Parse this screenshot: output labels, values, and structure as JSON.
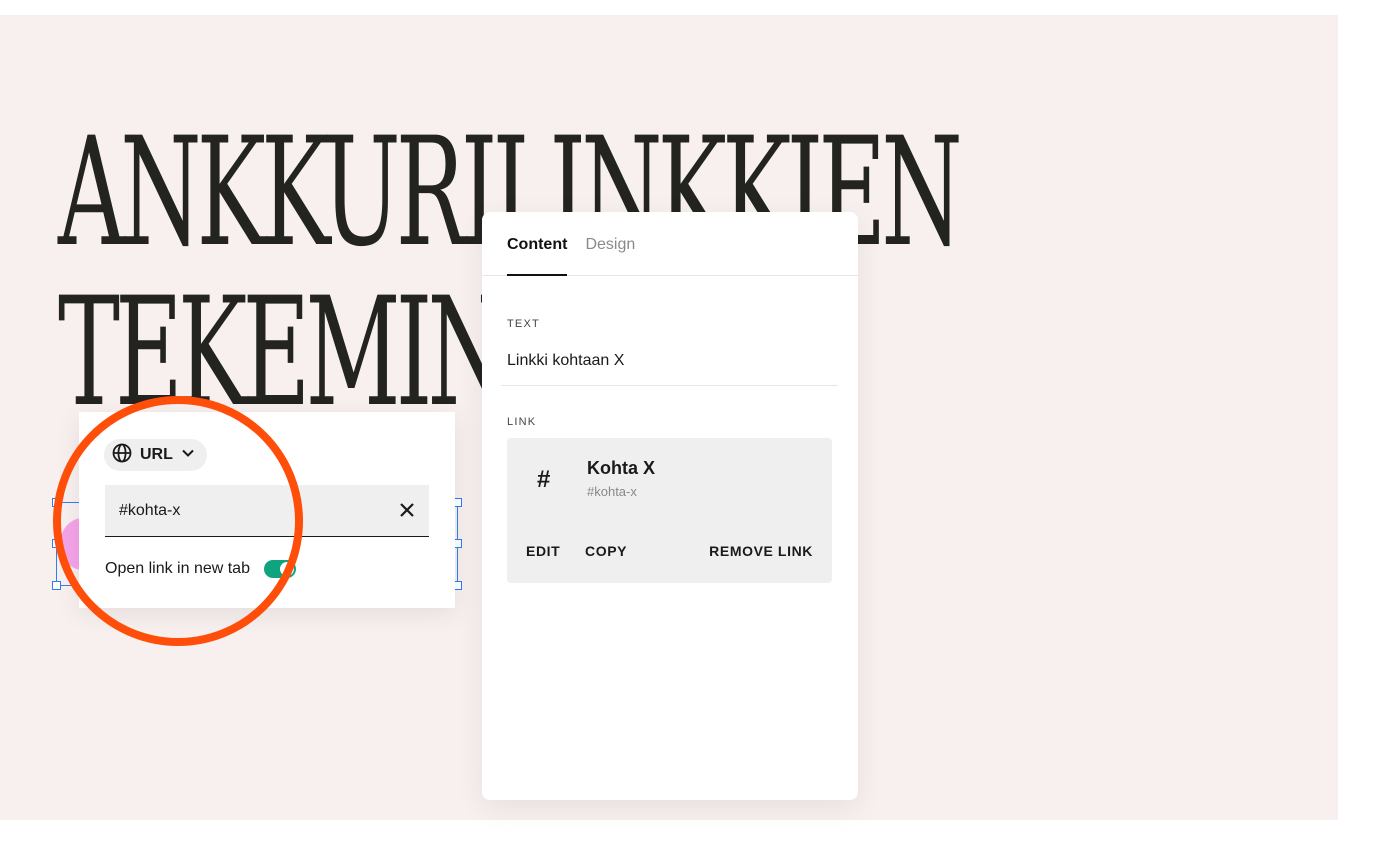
{
  "headline": {
    "line1": "ANKKURILINKKIEN",
    "line2": "TEKEMINEN"
  },
  "popover": {
    "type_label": "URL",
    "url_value": "#kohta-x",
    "new_tab_label": "Open link in new tab",
    "new_tab_on": true
  },
  "panel": {
    "tabs": [
      {
        "label": "Content",
        "active": true
      },
      {
        "label": "Design",
        "active": false
      }
    ],
    "text_section_label": "TEXT",
    "text_value": "Linkki kohtaan X",
    "link_section_label": "LINK",
    "link": {
      "icon_glyph": "#",
      "title": "Kohta X",
      "anchor": "#kohta-x",
      "actions": {
        "edit": "EDIT",
        "copy": "COPY",
        "remove": "REMOVE LINK"
      }
    }
  },
  "colors": {
    "canvas_bg": "#f8f0ee",
    "accent_ring": "#ff4e0a",
    "toggle_on": "#10a37f",
    "selection": "#2d7ff9"
  },
  "icons": {
    "type_icon": "globe-icon",
    "chevron": "chevron-down-icon",
    "clear": "close-icon"
  }
}
